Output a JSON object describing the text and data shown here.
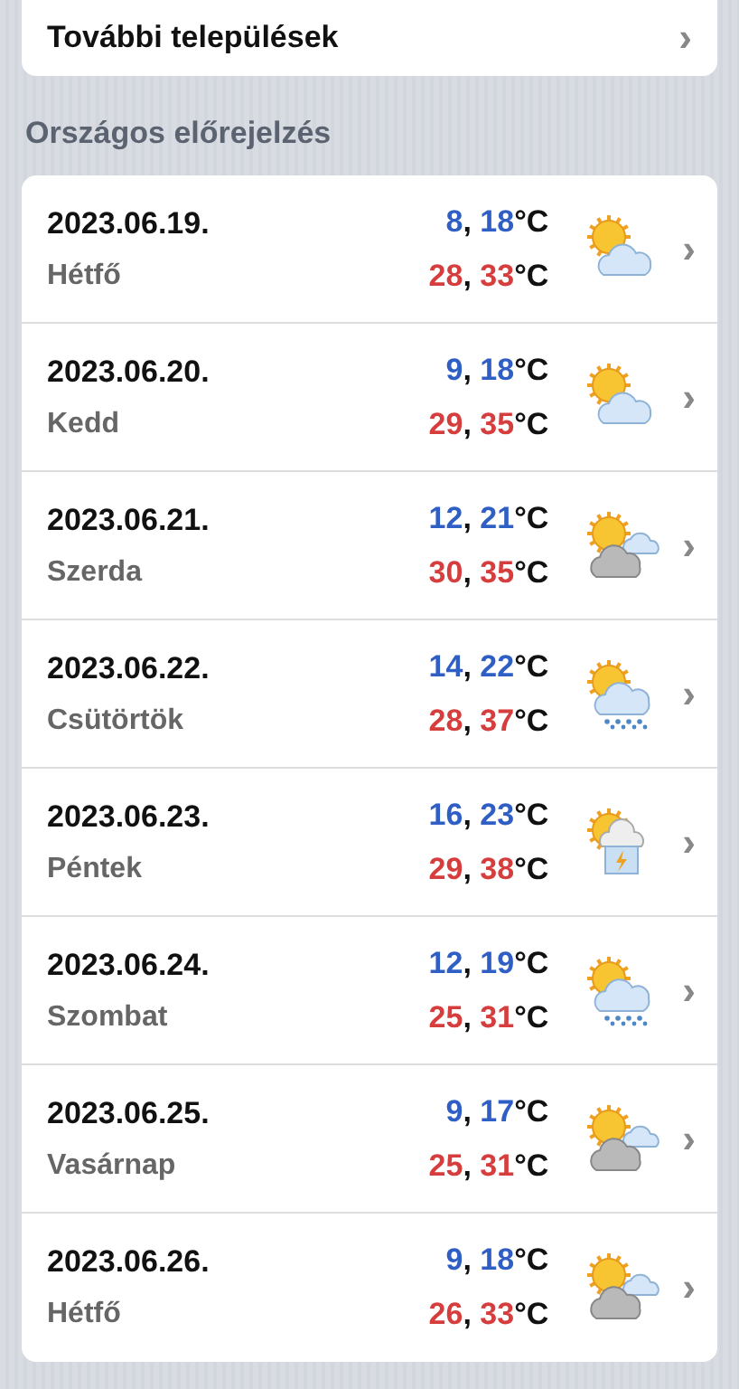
{
  "more_settlements": {
    "label": "További települések",
    "chevron": "›"
  },
  "section_title": "Országos előrejelzés",
  "days": [
    {
      "date": "2023.06.19.",
      "day": "Hétfő",
      "low": {
        "min": "8",
        "sep": ",",
        "max": "18",
        "unit": "°C"
      },
      "high": {
        "min": "28",
        "sep": ",",
        "max": "33",
        "unit": "°C"
      },
      "kind": "sun-cloud",
      "chevron": "›"
    },
    {
      "date": "2023.06.20.",
      "day": "Kedd",
      "low": {
        "min": "9",
        "sep": ",",
        "max": "18",
        "unit": "°C"
      },
      "high": {
        "min": "29",
        "sep": ",",
        "max": "35",
        "unit": "°C"
      },
      "kind": "sun-cloud",
      "chevron": "›"
    },
    {
      "date": "2023.06.21.",
      "day": "Szerda",
      "low": {
        "min": "12",
        "sep": ",",
        "max": "21",
        "unit": "°C"
      },
      "high": {
        "min": "30",
        "sep": ",",
        "max": "35",
        "unit": "°C"
      },
      "kind": "overcast",
      "chevron": "›"
    },
    {
      "date": "2023.06.22.",
      "day": "Csütörtök",
      "low": {
        "min": "14",
        "sep": ",",
        "max": "22",
        "unit": "°C"
      },
      "high": {
        "min": "28",
        "sep": ",",
        "max": "37",
        "unit": "°C"
      },
      "kind": "rain",
      "chevron": "›"
    },
    {
      "date": "2023.06.23.",
      "day": "Péntek",
      "low": {
        "min": "16",
        "sep": ",",
        "max": "23",
        "unit": "°C"
      },
      "high": {
        "min": "29",
        "sep": ",",
        "max": "38",
        "unit": "°C"
      },
      "kind": "storm",
      "chevron": "›"
    },
    {
      "date": "2023.06.24.",
      "day": "Szombat",
      "low": {
        "min": "12",
        "sep": ",",
        "max": "19",
        "unit": "°C"
      },
      "high": {
        "min": "25",
        "sep": ",",
        "max": "31",
        "unit": "°C"
      },
      "kind": "rain",
      "chevron": "›"
    },
    {
      "date": "2023.06.25.",
      "day": "Vasárnap",
      "low": {
        "min": "9",
        "sep": ",",
        "max": "17",
        "unit": "°C"
      },
      "high": {
        "min": "25",
        "sep": ",",
        "max": "31",
        "unit": "°C"
      },
      "kind": "overcast",
      "chevron": "›"
    },
    {
      "date": "2023.06.26.",
      "day": "Hétfő",
      "low": {
        "min": "9",
        "sep": ",",
        "max": "18",
        "unit": "°C"
      },
      "high": {
        "min": "26",
        "sep": ",",
        "max": "33",
        "unit": "°C"
      },
      "kind": "overcast",
      "chevron": "›"
    }
  ]
}
